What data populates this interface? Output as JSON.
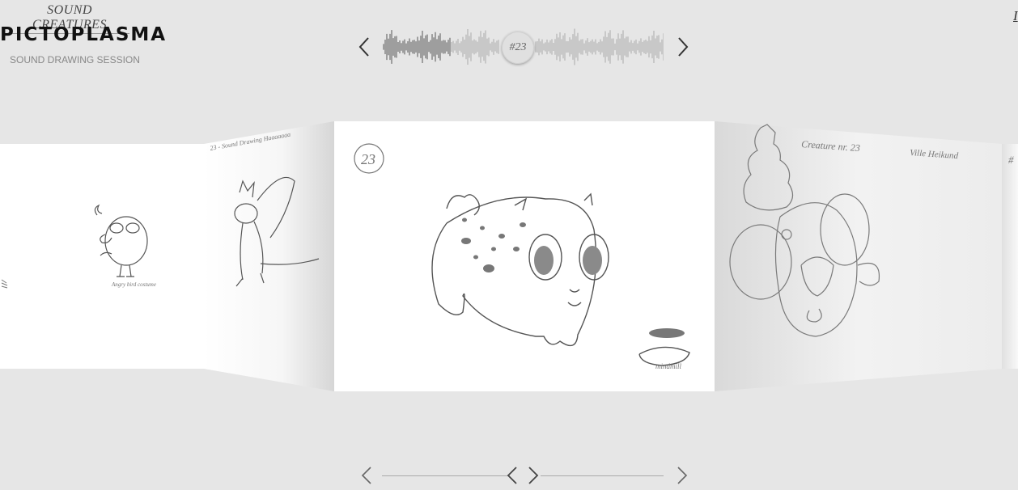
{
  "header": {
    "subtitle": "SOUND CREATURES",
    "brand": "PICTOPLASMA",
    "session": "SOUND DRAWING SESSION",
    "corner_link": "I"
  },
  "player": {
    "current_track": "#23",
    "prev_icon": "chevron-left-icon",
    "next_icon": "chevron-right-icon"
  },
  "drawings": {
    "left_panel_caption": "Angry bird costume",
    "mid_left_note": "23 - Sound Drawing Haaaaaaa",
    "center_number": "23",
    "center_signature": "mindmill",
    "right_panel_title": "Creature nr. 23",
    "right_panel_author": "Ville Heikund",
    "far_right_mark": "#"
  },
  "scrubber": {
    "start_icon": "chevron-left-icon",
    "back_icon": "chevron-left-icon",
    "forward_icon": "chevron-right-icon",
    "end_icon": "chevron-right-icon"
  },
  "colors": {
    "background": "#e6e6e6",
    "paper": "#ffffff",
    "pencil": "#555555"
  }
}
